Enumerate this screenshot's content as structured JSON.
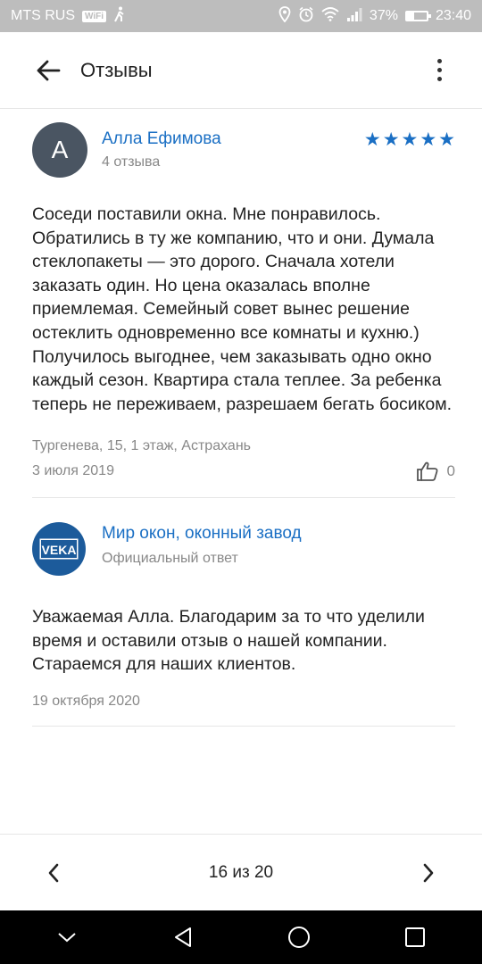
{
  "status_bar": {
    "carrier": "MTS RUS",
    "wifi_badge": "WiFi",
    "battery": "37%",
    "battery_level": 0.37,
    "time": "23:40"
  },
  "header": {
    "title": "Отзывы"
  },
  "review": {
    "avatar_letter": "A",
    "author": "Алла Ефимова",
    "reviews_count": "4 отзыва",
    "rating": 5,
    "rating_max": 5,
    "text": "Соседи поставили окна. Мне понравилось. Обратились в ту же компанию, что и они. Думала стеклопакеты — это дорого. Сначала хотели заказать один. Но цена оказалась вполне приемлемая. Семейный совет вынес решение остеклить одновременно все комнаты и кухню.) Получилось выгоднее, чем заказывать одно окно каждый сезон. Квартира стала теплее. За ребенка теперь не переживаем, разрешаем бегать босиком.",
    "address": "Тургенева, 15, 1 этаж, Астрахань",
    "date": "3 июля 2019",
    "likes": "0"
  },
  "reply": {
    "logo_text": "VEKA",
    "author": "Мир окон, оконный завод",
    "subtitle": "Официальный ответ",
    "text": "Уважаемая Алла. Благодарим за то что уделили время и оставили отзыв о нашей компании. Стараемся для наших клиентов.",
    "date": "19 октября 2020"
  },
  "pager": {
    "label": "16 из 20"
  },
  "colors": {
    "accent": "#1a6fc4",
    "status_bar": "#bdbdbd",
    "avatar": "#4a5562",
    "logo": "#1c5b9b"
  },
  "icons": {
    "back": "arrow-left-icon",
    "menu": "more-vertical-icon",
    "star": "star-icon",
    "like": "thumbs-up-icon",
    "prev": "chevron-left-icon",
    "next": "chevron-right-icon"
  }
}
